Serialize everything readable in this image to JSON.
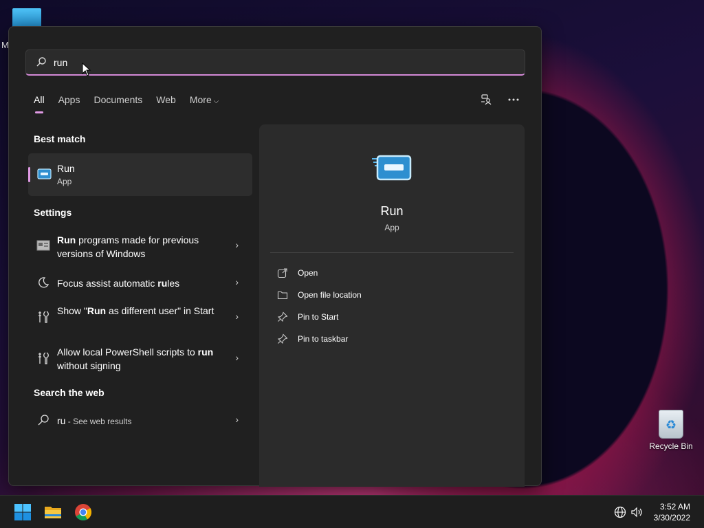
{
  "desktop": {
    "partial_label": "M",
    "recycle_bin_label": "Recycle Bin"
  },
  "search": {
    "query": "run"
  },
  "tabs": [
    {
      "label": "All"
    },
    {
      "label": "Apps"
    },
    {
      "label": "Documents"
    },
    {
      "label": "Web"
    },
    {
      "label": "More"
    }
  ],
  "best_match": {
    "heading": "Best match",
    "title": "Run",
    "subtitle": "App"
  },
  "settings": {
    "heading": "Settings",
    "items": [
      {
        "pre": "",
        "bold": "Run",
        "post": " programs made for previous versions of Windows",
        "icon": "compat-icon"
      },
      {
        "pre": "Focus assist automatic ",
        "bold": "ru",
        "post": "les",
        "icon": "moon-icon"
      },
      {
        "pre": "Show \"",
        "bold": "Run",
        "post": " as different user\" in Start",
        "icon": "tools-icon"
      },
      {
        "pre": "Allow local PowerShell scripts to ",
        "bold": "run",
        "post": " without signing",
        "icon": "tools-icon"
      }
    ]
  },
  "web": {
    "heading": "Search the web",
    "query": "ru",
    "suffix": " - See web results"
  },
  "detail": {
    "title": "Run",
    "subtitle": "App",
    "actions": [
      {
        "label": "Open",
        "icon": "open-icon"
      },
      {
        "label": "Open file location",
        "icon": "folder-icon"
      },
      {
        "label": "Pin to Start",
        "icon": "pin-icon"
      },
      {
        "label": "Pin to taskbar",
        "icon": "pin-icon"
      }
    ]
  },
  "taskbar": {
    "time": "3:52 AM",
    "date": "3/30/2022"
  },
  "colors": {
    "accent": "#e09ae4",
    "panel_bg": "#202020",
    "detail_bg": "#2b2b2b"
  }
}
